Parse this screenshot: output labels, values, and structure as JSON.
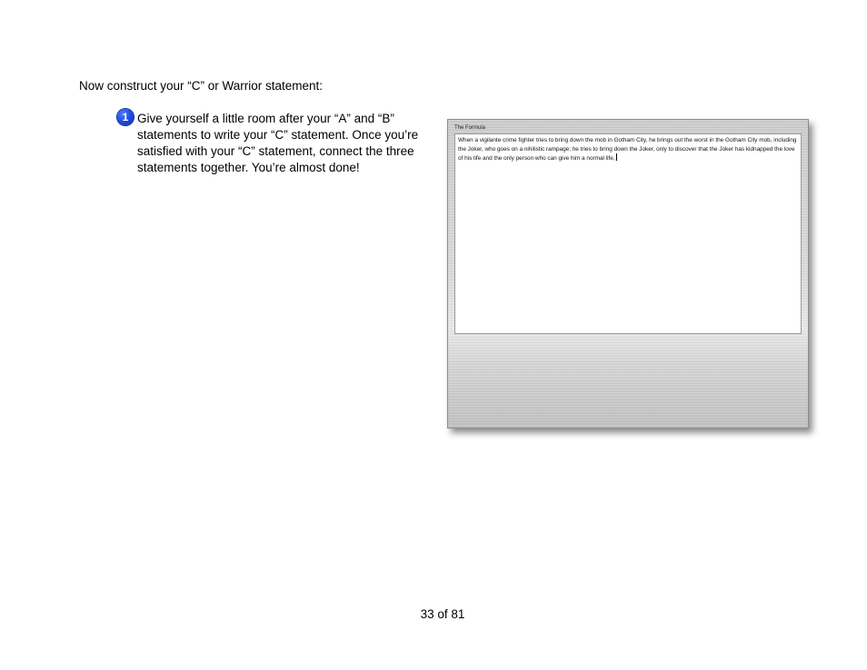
{
  "instructions": {
    "intro": "Now construct your “C” or Warrior statement:",
    "step_number": "1",
    "step_text": "Give yourself a little room after your “A” and “B” statements to write your “C” statement. Once you’re satisfied with your “C” statement, connect the three statements together. You’re almost done!"
  },
  "window": {
    "title": "The Formula",
    "text_value": "When a vigilante crime fighter tries to bring down the mob in Gotham City, he brings out the worst in the Gotham City mob, including the Joker, who goes on a nihilistic rampage; he tries to bring down the Joker, only to discover that the Joker has kidnapped the love of his life and the only person who can give him a normal life,"
  },
  "footer": {
    "page": "33 of 81"
  }
}
